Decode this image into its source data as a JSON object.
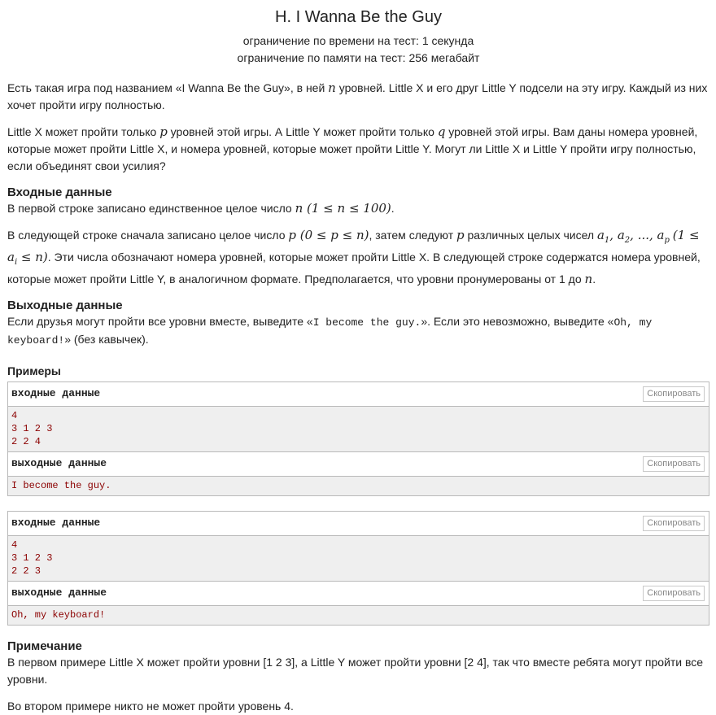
{
  "header": {
    "title": "H. I Wanna Be the Guy",
    "time_limit": "ограничение по времени на тест: 1 секунда",
    "memory_limit": "ограничение по памяти на тест: 256 мегабайт"
  },
  "statement": {
    "p1_a": "Есть такая игра под названием «I Wanna Be the Guy», в ней ",
    "p1_n": "n",
    "p1_b": " уровней. Little X и его друг Little Y подсели на эту игру. Каждый из них хочет пройти игру полностью.",
    "p2_a": "Little X может пройти только ",
    "p2_p": "p",
    "p2_b": " уровней этой игры. А Little Y может пройти только ",
    "p2_q": "q",
    "p2_c": " уровней этой игры. Вам даны номера уровней, которые может пройти Little X, и номера уровней, которые может пройти Little Y. Могут ли Little X и Little Y пройти игру полностью, если объединят свои усилия?"
  },
  "input_spec": {
    "heading": "Входные данные",
    "l1_a": "В первой строке записано единственное целое число ",
    "l1_math": "n (1 ≤ n ≤ 100)",
    "l1_b": ".",
    "l2_a": "В следующей строке сначала записано целое число ",
    "l2_m1": "p (0 ≤ p ≤ n)",
    "l2_b": ", затем следуют ",
    "l2_p": "p",
    "l2_c": " различных целых чисел ",
    "l2_m2": "a",
    "l2_m2_sub1": "1",
    "l2_m2_sep1": ", a",
    "l2_m2_sub2": "2",
    "l2_m2_sep2": ", ..., a",
    "l2_m2_sub3": "p",
    "l2_m3": "(1 ≤ a",
    "l2_m3_sub": "i",
    "l2_m3_end": " ≤ n)",
    "l2_d": ". Эти числа обозначают номера уровней, которые может пройти Little X. В следующей строке содержатся номера уровней, которые может пройти Little Y, в аналогичном формате. Предполагается, что уровни пронумерованы от 1 до ",
    "l2_n": "n",
    "l2_e": "."
  },
  "output_spec": {
    "heading": "Выходные данные",
    "a": "Если друзья могут пройти все уровни вместе, выведите «",
    "yes": "I become the guy.",
    "b": "». Если это невозможно, выведите «",
    "no": "Oh, my keyboard!",
    "c": "» (без кавычек)."
  },
  "examples": {
    "heading": "Примеры",
    "input_label": "входные данные",
    "output_label": "выходные данные",
    "copy_label": "Скопировать",
    "samples": [
      {
        "input": [
          "4",
          "3 1 2 3",
          "2 2 4"
        ],
        "output": [
          "I become the guy."
        ]
      },
      {
        "input": [
          "4",
          "3 1 2 3",
          "2 2 3"
        ],
        "output": [
          "Oh, my keyboard!"
        ]
      }
    ]
  },
  "note": {
    "heading": "Примечание",
    "p1": "В первом примере Little X может пройти уровни [1 2 3], а Little Y может пройти уровни [2 4], так что вместе ребята могут пройти все уровни.",
    "p2": "Во втором примере никто не может пройти уровень 4."
  }
}
